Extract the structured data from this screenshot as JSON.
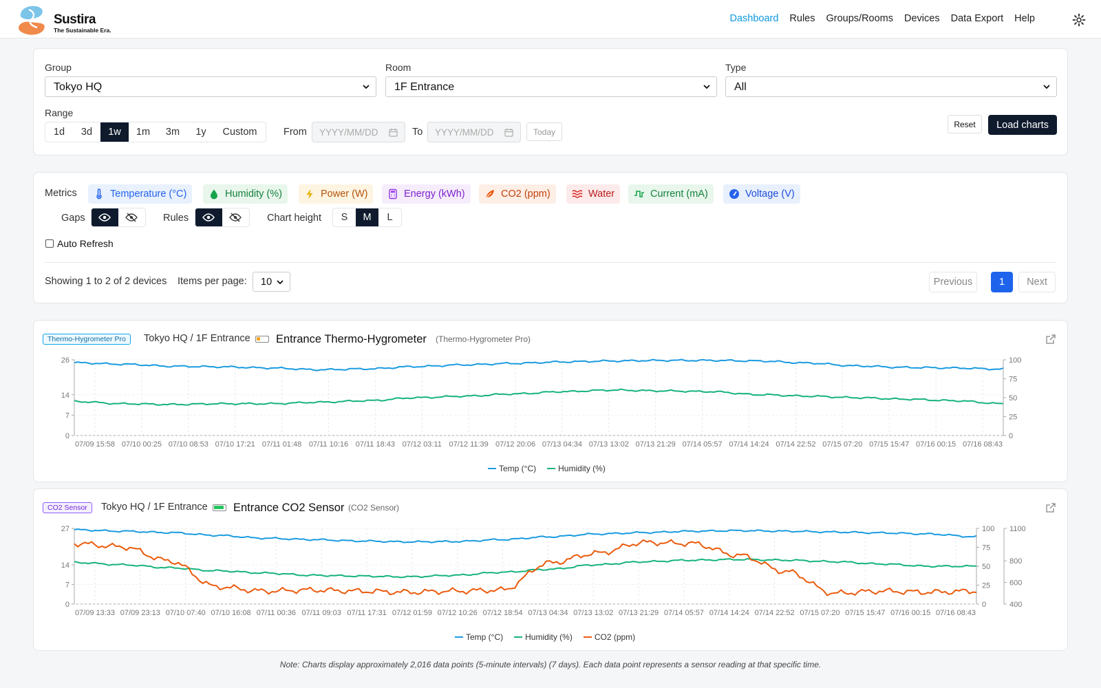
{
  "app": {
    "brand": "Sustira",
    "tagline": "The Sustainable Era."
  },
  "nav": [
    "Dashboard",
    "Rules",
    "Groups/Rooms",
    "Devices",
    "Data Export",
    "Help"
  ],
  "filters": {
    "group_label": "Group",
    "group_value": "Tokyo HQ",
    "room_label": "Room",
    "room_value": "1F Entrance",
    "type_label": "Type",
    "type_value": "All",
    "range_label": "Range",
    "ranges": [
      "1d",
      "3d",
      "1w",
      "1m",
      "3m",
      "1y",
      "Custom"
    ],
    "range_selected": "1w",
    "from_label": "From",
    "from_placeholder": "YYYY/MM/DD",
    "to_label": "To",
    "to_placeholder": "YYYY/MM/DD",
    "today": "Today",
    "reset": "Reset",
    "load": "Load charts"
  },
  "metrics": {
    "label": "Metrics",
    "items": [
      {
        "label": "Temperature (°C)",
        "icon": "thermometer-icon",
        "color": "#2563eb",
        "bg": "#e8f1fd"
      },
      {
        "label": "Humidity (%)",
        "icon": "droplet-icon",
        "color": "#15803d",
        "bg": "#e8f6ec"
      },
      {
        "label": "Power (W)",
        "icon": "bolt-icon",
        "color": "#b45309",
        "bg": "#fdf4e2"
      },
      {
        "label": "Energy (kWh)",
        "icon": "calculator-icon",
        "color": "#7e22ce",
        "bg": "#f5ecfc"
      },
      {
        "label": "CO2 (ppm)",
        "icon": "leaf-icon",
        "color": "#c2410c",
        "bg": "#fdeee6"
      },
      {
        "label": "Water",
        "icon": "waves-icon",
        "color": "#b91c1c",
        "bg": "#fdeaea"
      },
      {
        "label": "Current (mA)",
        "icon": "pulse-icon",
        "color": "#15803d",
        "bg": "#e8f6ec"
      },
      {
        "label": "Voltage (V)",
        "icon": "gauge-icon",
        "color": "#1d4ed8",
        "bg": "#e8f0fd"
      }
    ],
    "gaps_label": "Gaps",
    "rules_label": "Rules",
    "height_label": "Chart height",
    "heights": [
      "S",
      "M",
      "L"
    ],
    "height_selected": "M",
    "auto_refresh": "Auto Refresh"
  },
  "paging": {
    "showing": "Showing 1 to 2 of 2 devices",
    "per_page_label": "Items per page:",
    "per_page": "10",
    "prev": "Previous",
    "page": "1",
    "next": "Next"
  },
  "devices": [
    {
      "badge": "Thermo-Hygrometer Pro",
      "path": "Tokyo HQ / 1F Entrance",
      "name": "Entrance Thermo-Hygrometer",
      "type": "(Thermo-Hygrometer Pro)",
      "battery_level": 0.35,
      "battery_color": "#f5a623"
    },
    {
      "badge": "CO2 Sensor",
      "path": "Tokyo HQ / 1F Entrance",
      "name": "Entrance CO2 Sensor",
      "type": "(CO2 Sensor)",
      "battery_level": 0.9,
      "battery_color": "#22c55e"
    }
  ],
  "note": "Note: Charts display approximately 2,016 data points (5-minute intervals) (7 days). Each data point represents a sensor reading at that specific time.",
  "chart_data": [
    {
      "type": "line",
      "x": [
        "07/09 15:58",
        "07/10 00:25",
        "07/10 08:53",
        "07/10 17:21",
        "07/11 01:48",
        "07/11 10:16",
        "07/11 18:43",
        "07/12 03:11",
        "07/12 11:39",
        "07/12 20:06",
        "07/13 04:34",
        "07/13 13:02",
        "07/13 21:29",
        "07/14 05:57",
        "07/14 14:24",
        "07/14 22:52",
        "07/15 07:20",
        "07/15 15:47",
        "07/16 00:15",
        "07/16 08:43"
      ],
      "left_ticks": [
        "0",
        "7",
        "14",
        "26"
      ],
      "left_ylim": [
        0,
        26
      ],
      "right_ticks": [
        "0",
        "25",
        "50",
        "75",
        "100"
      ],
      "right_ylim": [
        0,
        100
      ],
      "series": [
        {
          "name": "Temp (°C)",
          "color": "#1a9be0",
          "axis": "left",
          "values": [
            25,
            24.5,
            23.8,
            23.6,
            23.2,
            22.6,
            22.9,
            23.7,
            24.3,
            24.8,
            25.3,
            25.6,
            25.8,
            25.8,
            25.6,
            24.9,
            23.9,
            23.4,
            23.2,
            22.8
          ]
        },
        {
          "name": "Humidity (%)",
          "color": "#16b37a",
          "axis": "right",
          "values": [
            45,
            42,
            41,
            42,
            42,
            44,
            46,
            50,
            52,
            55,
            58,
            60,
            59,
            58,
            54,
            52,
            50,
            48,
            46,
            42
          ]
        }
      ]
    },
    {
      "type": "line",
      "x": [
        "07/09 13:33",
        "07/09 23:13",
        "07/10 07:40",
        "07/10 16:08",
        "07/11 00:36",
        "07/11 09:03",
        "07/11 17:31",
        "07/12 01:59",
        "07/12 10:26",
        "07/12 18:54",
        "07/13 04:34",
        "07/13 13:02",
        "07/13 21:29",
        "07/14 05:57",
        "07/14 14:24",
        "07/14 22:52",
        "07/15 07:20",
        "07/15 15:47",
        "07/16 00:15",
        "07/16 08:43"
      ],
      "left_ticks": [
        "0",
        "7",
        "14",
        "27"
      ],
      "left_ylim": [
        0,
        27
      ],
      "right_ticks": [
        "0",
        "25",
        "50",
        "75",
        "100"
      ],
      "right_ylim": [
        0,
        100
      ],
      "right2_ticks": [
        "400",
        "600",
        "800",
        "1100"
      ],
      "right2_ylim": [
        400,
        1100
      ],
      "series": [
        {
          "name": "Temp (°C)",
          "color": "#1a9be0",
          "axis": "left",
          "values": [
            26.5,
            26,
            25.5,
            24.5,
            23.5,
            23,
            22.5,
            22.2,
            22.3,
            23,
            24,
            25,
            25.5,
            26,
            26.2,
            26,
            25.7,
            25.4,
            25,
            24
          ]
        },
        {
          "name": "Humidity (%)",
          "color": "#16b37a",
          "axis": "right",
          "values": [
            55,
            52,
            48,
            44,
            41,
            38,
            37,
            36,
            38,
            42,
            46,
            52,
            56,
            58,
            59,
            58,
            56,
            53,
            50,
            50
          ]
        },
        {
          "name": "CO2 (ppm)",
          "color": "#ea5a0c",
          "axis": "right2",
          "values": [
            960,
            930,
            800,
            560,
            520,
            530,
            520,
            510,
            520,
            530,
            780,
            870,
            970,
            960,
            850,
            700,
            500,
            520,
            510,
            520
          ]
        }
      ]
    }
  ]
}
